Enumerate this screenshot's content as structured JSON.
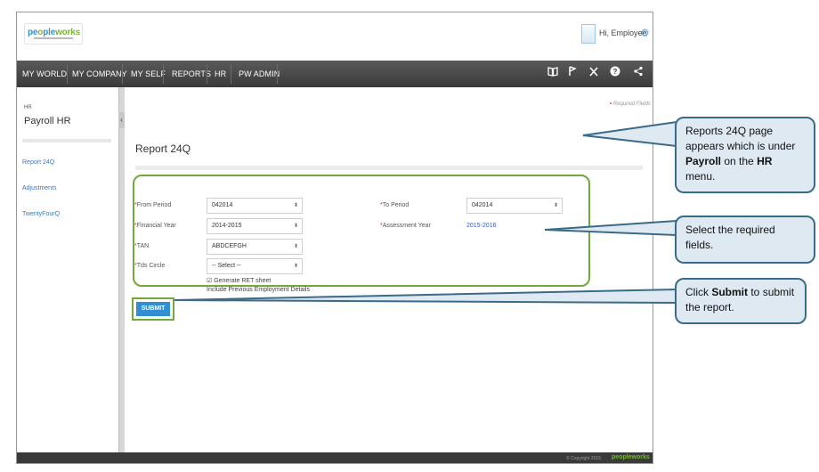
{
  "header": {
    "logo_text_a": "pe",
    "logo_text_b": "o",
    "logo_text_c": "ple",
    "logo_text_d": "works",
    "greeting": "Hi, Employee"
  },
  "nav": {
    "items": [
      "MY WORLD",
      "MY COMPANY",
      "MY SELF",
      "REPORTS",
      "HR",
      "PW ADMIN"
    ],
    "icons": [
      "book-icon",
      "flag-icon",
      "tools-icon",
      "help-icon",
      "share-icon"
    ]
  },
  "sidebar": {
    "crumb": "HR",
    "title": "Payroll HR",
    "items": [
      "Report 24Q",
      "Adjustments",
      "TwentyFourQ"
    ]
  },
  "page": {
    "required_note": "Required Fields",
    "title": "Report 24Q"
  },
  "form": {
    "from_period_label": "From Period",
    "from_period_value": "042014",
    "to_period_label": "To Period",
    "to_period_value": "042014",
    "financial_year_label": "Financial Year",
    "financial_year_value": "2014-2015",
    "assessment_year_label": "Assessment Year",
    "assessment_year_value": "2015-2016",
    "tan_label": "TAN",
    "tan_value": "ABDCEFGH",
    "tds_circle_label": "Tds Circle",
    "tds_circle_value": "-- Select --",
    "generate_ret_label": "Generate RET sheet",
    "include_prev_label": "Include Previous Employment Details",
    "submit_label": "SUBMIT"
  },
  "footer": {
    "copyright": "© Copyright 2015",
    "logo": "peopleworks"
  },
  "callouts": {
    "c1_pre": "Reports 24Q page appears which is under ",
    "c1_b1": "Payroll",
    "c1_mid": " on the ",
    "c1_b2": "HR",
    "c1_post": " menu.",
    "c2": "Select the required fields.",
    "c3_pre": "Click ",
    "c3_b": "Submit",
    "c3_post": " to submit the report."
  },
  "colors": {
    "nav_bg": "#3a3a3a",
    "highlight_green": "#73a83a",
    "submit_blue": "#2f8fd0",
    "callout_fill": "#dfe9f2",
    "callout_border": "#3a6b88"
  }
}
